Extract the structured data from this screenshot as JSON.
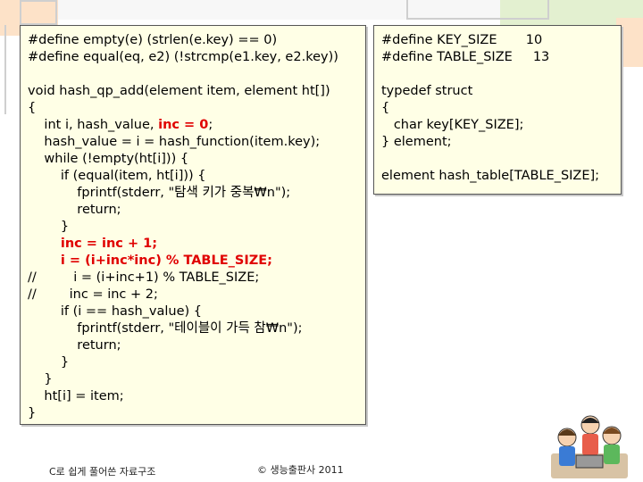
{
  "code_panel": {
    "lines": [
      {
        "text": "#define empty(e) (strlen(e.key) == 0)"
      },
      {
        "text": "#define equal(eq, e2) (!strcmp(e1.key, e2.key))"
      },
      {
        "text": ""
      },
      {
        "text": "void hash_qp_add(element item, element ht[])"
      },
      {
        "text": "{"
      },
      {
        "pre": "    int i, hash_value, ",
        "hl": "inc = 0",
        "post": ";"
      },
      {
        "text": "    hash_value = i = hash_function(item.key);"
      },
      {
        "text": "    while (!empty(ht[i])) {"
      },
      {
        "text": "        if (equal(item, ht[i])) {"
      },
      {
        "text": "            fprintf(stderr, \"탐색 키가 중복₩n\");"
      },
      {
        "text": "            return;"
      },
      {
        "text": "        }"
      },
      {
        "pre": "        ",
        "hl": "inc = inc + 1;",
        "post": ""
      },
      {
        "pre": "        ",
        "hl": "i = (i+inc*inc) % TABLE_SIZE;",
        "post": ""
      },
      {
        "text": "//         i = (i+inc+1) % TABLE_SIZE;"
      },
      {
        "text": "//        inc = inc + 2;"
      },
      {
        "text": "        if (i == hash_value) {"
      },
      {
        "text": "            fprintf(stderr, \"테이블이 가득 참₩n\");"
      },
      {
        "text": "            return;"
      },
      {
        "text": "        }"
      },
      {
        "text": "    }"
      },
      {
        "text": "    ht[i] = item;"
      },
      {
        "text": "}"
      }
    ]
  },
  "side_panel": {
    "lines": [
      {
        "text": "#define KEY_SIZE       10"
      },
      {
        "text": "#define TABLE_SIZE     13"
      },
      {
        "text": ""
      },
      {
        "text": "typedef struct"
      },
      {
        "text": "{"
      },
      {
        "text": "   char key[KEY_SIZE];"
      },
      {
        "text": "} element;"
      },
      {
        "text": ""
      },
      {
        "text": "element hash_table[TABLE_SIZE];"
      }
    ]
  },
  "footer": {
    "left": "C로 쉽게 풀어쓴 자료구조",
    "right": "© 생능출판사 2011"
  },
  "colors": {
    "highlight": "#e00000",
    "panel_bg": "#ffffe6",
    "deco_peach": "#fde2c8",
    "deco_green": "#e3f0d0",
    "deco_gray": "#cfcfcf"
  },
  "icons": [
    "children-illustration"
  ]
}
